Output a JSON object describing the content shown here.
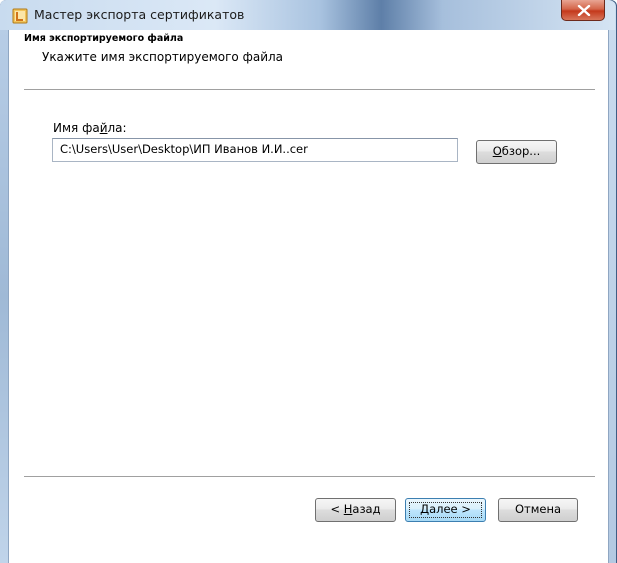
{
  "window": {
    "title": "Мастер экспорта сертификатов",
    "close_symbol": "X",
    "icon": "certificate-wizard-icon"
  },
  "header": {
    "title": "Имя экспортируемого файла",
    "subtitle": "Укажите имя экспортируемого файла"
  },
  "file_field": {
    "label_before": "Имя фа",
    "label_mnemonic": "й",
    "label_after": "ла:",
    "value": "C:\\Users\\User\\Desktop\\ИП Иванов И.И..cer"
  },
  "buttons": {
    "browse_mnemonic": "О",
    "browse_rest": "бзор...",
    "back_prefix": "< ",
    "back_mnemonic": "Н",
    "back_rest": "азад",
    "next_mnemonic": "Д",
    "next_rest": "алее >",
    "cancel": "Отмена"
  },
  "colors": {
    "close_button": "#c4391c",
    "default_button_border": "#3c7fb1"
  }
}
